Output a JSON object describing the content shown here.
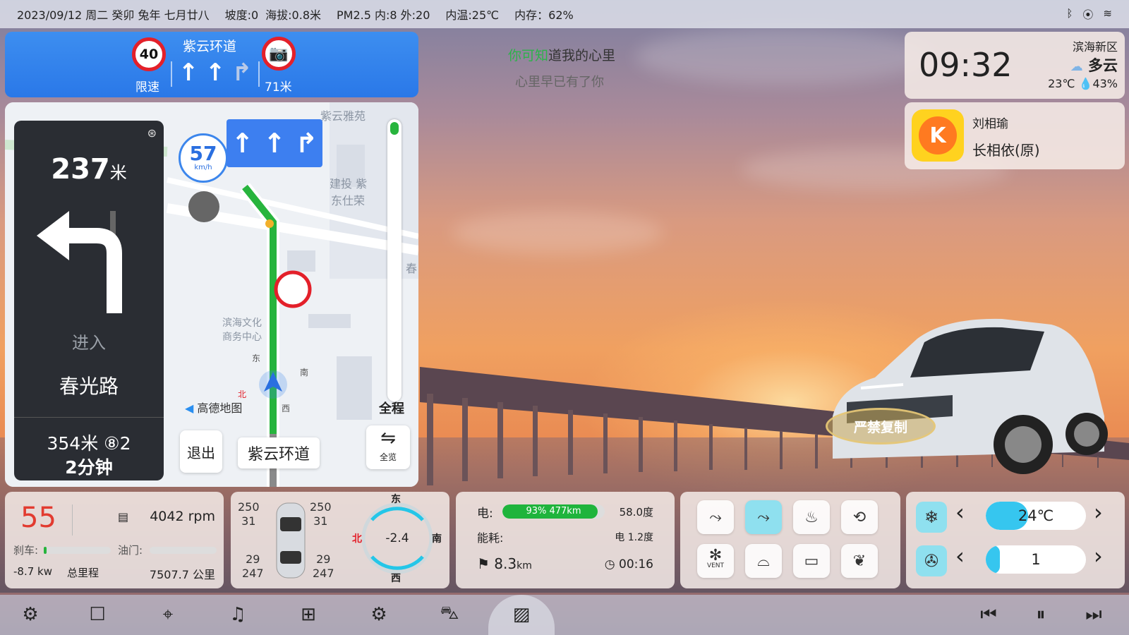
{
  "statusbar": {
    "date": "2023/09/12 周二 癸卯 兔年 七月廿八",
    "slope": "坡度:0",
    "altitude": "海拔:0.8米",
    "pm25": "PM2.5 内:8 外:20",
    "inner_temp": "内温:25℃",
    "memory": "内存：62%"
  },
  "nav": {
    "speed_limit": "40",
    "speed_limit_label": "限速",
    "road_name": "紫云环道",
    "camera_distance": "71米",
    "turn_distance": "237",
    "turn_distance_unit": "米",
    "enter_label": "进入",
    "next_street": "春光路",
    "next_info": "354米 ⑧2",
    "remaining_time": "2分钟",
    "current_speed": "57",
    "current_speed_unit": "km/h",
    "full_route_label": "全程",
    "exit_label": "退出",
    "current_road": "紫云环道",
    "overview_label": "全览",
    "amap_logo": "高德地图",
    "map_labels": [
      "紫云雅苑",
      "建投 紫",
      "东仕荣",
      "滨海文化",
      "商务中心",
      "春",
      "东",
      "南",
      "北",
      "西"
    ]
  },
  "lyrics": {
    "line1_highlight": "你可知",
    "line1_rest": "道我的心里",
    "line2": "心里早已有了你"
  },
  "clock": {
    "time": "09:32",
    "city": "滨海新区",
    "condition": "多云",
    "temp": "23℃",
    "humidity": "43%"
  },
  "music": {
    "artist": "刘相瑜",
    "song": "长相依(原)"
  },
  "watermark": "严禁复制",
  "drive": {
    "speed": "55",
    "rpm": "4042 rpm",
    "brake_label": "刹车:",
    "brake_level": 0.04,
    "throttle_label": "油门:",
    "throttle_level": 0,
    "power": "-8.7 kw",
    "odo_label": "总里程",
    "odo": "7507.7 公里"
  },
  "tires": {
    "fl_pressure": "250",
    "fl_temp": "31",
    "fr_pressure": "250",
    "fr_temp": "31",
    "rl_temp": "29",
    "rl_pressure": "247",
    "rr_temp": "29",
    "rr_pressure": "247"
  },
  "compass": {
    "value": "-2.4",
    "east": "东",
    "south": "南",
    "west": "西",
    "north": "北"
  },
  "energy": {
    "label": "电:",
    "battery_text": "93% 477km",
    "battery_level": 0.93,
    "capacity": "58.0度",
    "consumption_label": "能耗:",
    "consumption": "电 1.2度",
    "trip": "8.3",
    "trip_unit": "km",
    "trip_time": "00:16"
  },
  "ac": {
    "vent_label": "VENT"
  },
  "climate": {
    "temp": "24℃",
    "temp_level": 0.42,
    "fan": "1",
    "fan_level": 0.14
  },
  "colors": {
    "nav_blue": "#2a78e8",
    "speed_red": "#e23b30",
    "battery_green": "#1fb43c",
    "ac_active": "#8fe0ef",
    "slider_blue": "#36c6ef"
  }
}
